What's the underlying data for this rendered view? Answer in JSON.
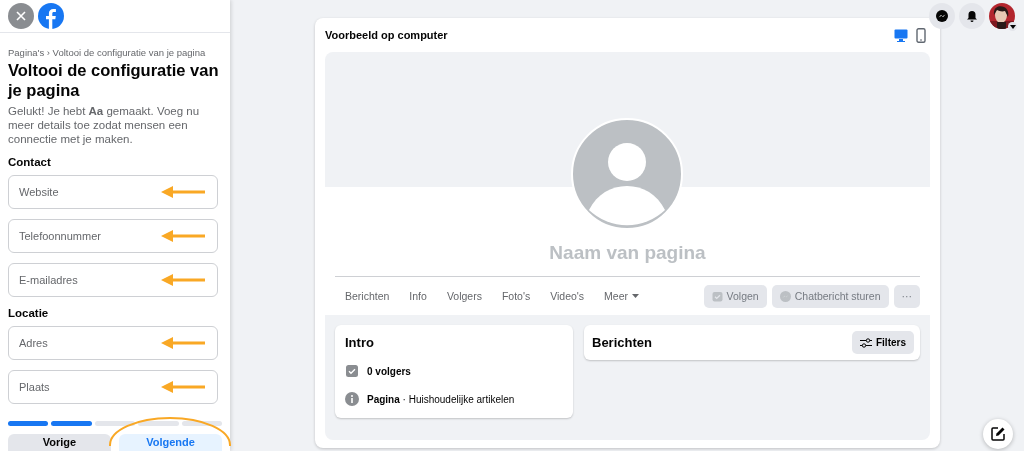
{
  "breadcrumb": "Pagina's › Voltooi de configuratie van je pagina",
  "title": "Voltooi de configuratie van je pagina",
  "intro": "Gelukt! Je hebt **Aa** gemaakt. Voeg nu meer details toe zodat mensen een connectie met je maken.",
  "sections": [
    {
      "heading": "Contact",
      "fields": [
        {
          "placeholder": "Website",
          "marked": true
        },
        {
          "placeholder": "Telefoonnummer",
          "marked": true
        },
        {
          "placeholder": "E-mailadres",
          "marked": true
        }
      ]
    },
    {
      "heading": "Locatie",
      "fields": [
        {
          "placeholder": "Adres",
          "marked": true
        },
        {
          "placeholder": "Plaats",
          "marked": true
        }
      ]
    }
  ],
  "progress": [
    {
      "done": true
    },
    {
      "done": true
    },
    {
      "done": false
    },
    {
      "done": false
    },
    {
      "done": false
    }
  ],
  "buttons": [
    {
      "label": "Vorige",
      "kind": "secondary",
      "circled": false
    },
    {
      "label": "Volgende",
      "kind": "primary",
      "circled": true
    }
  ],
  "preview": {
    "title": "Voorbeeld op computer",
    "views": [
      {
        "kind": "desktop",
        "selected": true
      },
      {
        "kind": "mobile",
        "selected": false
      }
    ],
    "page_name": "Naam van pagina",
    "tabs": [
      {
        "label": "Berichten",
        "dropdown": false
      },
      {
        "label": "Info",
        "dropdown": false
      },
      {
        "label": "Volgers",
        "dropdown": false
      },
      {
        "label": "Foto's",
        "dropdown": false
      },
      {
        "label": "Video's",
        "dropdown": false
      },
      {
        "label": "Meer",
        "dropdown": true
      }
    ],
    "actions": [
      {
        "kind": "follow",
        "label": "Volgen",
        "disabled": true
      },
      {
        "kind": "message",
        "label": "Chatbericht sturen",
        "disabled": true
      },
      {
        "kind": "more",
        "label": "···",
        "disabled": true
      }
    ],
    "intro": {
      "title": "Intro",
      "items": [
        {
          "kind": "followers",
          "text": "**0 volgers**"
        },
        {
          "kind": "info",
          "text": "**Pagina** · Huishoudelijke artikelen"
        }
      ]
    },
    "posts": {
      "title": "Berichten",
      "filter": "Filters"
    }
  }
}
